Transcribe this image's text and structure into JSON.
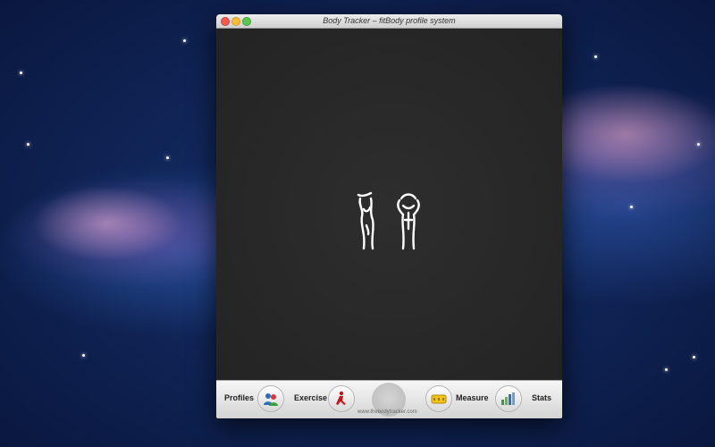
{
  "window": {
    "title": "Body Tracker – fitBody profile system"
  },
  "toolbar": {
    "profiles_label": "Profiles",
    "exercise_label": "Exercise",
    "measure_label": "Measure",
    "stats_label": "Stats",
    "website": "www.thebodytracker.com"
  },
  "icons": {
    "close": "close-icon",
    "minimize": "minimize-icon",
    "maximize": "maximize-icon",
    "profiles": "people-icon",
    "exercise": "exercise-figure-icon",
    "measure": "tape-measure-icon",
    "stats": "bar-chart-icon",
    "logo": "body-silhouettes-logo"
  },
  "colors": {
    "content_bg": "#2b2b2b",
    "toolbar_bg": "#e3e3e3",
    "close": "#ee5b52",
    "minimize": "#f6bd3b",
    "maximize": "#5fc454",
    "exercise_figure": "#c0161c",
    "measure_tape": "#f3c31a",
    "profiles_blue": "#2d6fb8",
    "profiles_red": "#d43a3a",
    "profiles_green": "#3a9f3a"
  }
}
